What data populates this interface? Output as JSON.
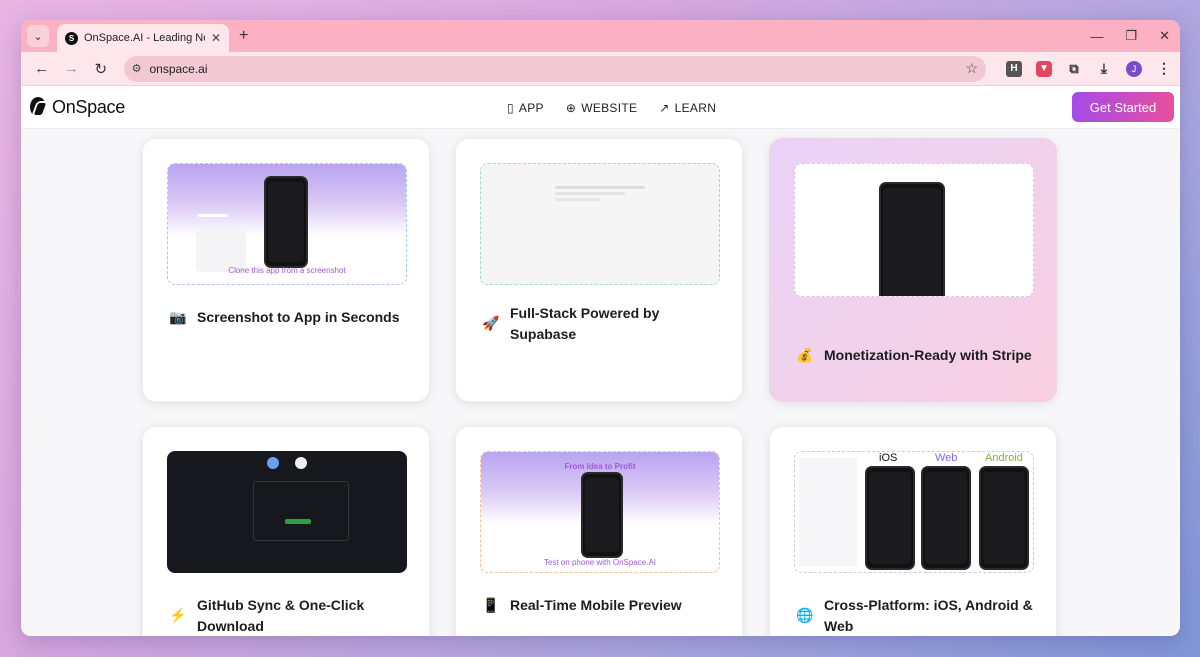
{
  "browser": {
    "tab_title": "OnSpace.AI - Leading No-Code",
    "tab_close": "✕",
    "new_tab": "+",
    "url": "onspace.ai",
    "avatar_initial": "J",
    "ext_h": "H"
  },
  "site": {
    "logo_text": "OnSpace",
    "nav": [
      {
        "label": "APP",
        "icon": "phone-icon"
      },
      {
        "label": "WEBSITE",
        "icon": "globe-icon"
      },
      {
        "label": "LEARN",
        "icon": "arrow-up-right-icon"
      }
    ],
    "cta_label": "Get Started"
  },
  "cards": [
    {
      "emoji": "📷",
      "title": "Screenshot to App in Seconds",
      "caption": "Clone this app from a screenshot"
    },
    {
      "emoji": "🚀",
      "title": "Full-Stack Powered by Supabase"
    },
    {
      "emoji": "💰",
      "title": "Monetization-Ready with Stripe"
    },
    {
      "emoji": "⚡",
      "title": "GitHub Sync & One-Click Download"
    },
    {
      "emoji": "📱",
      "title": "Real-Time Mobile Preview",
      "caption_top": "From Idea to Profit",
      "caption_bottom": "Test on phone with OnSpace.AI"
    },
    {
      "emoji": "🌐",
      "title": "Cross-Platform: iOS, Android & Web",
      "labels": [
        "iOS",
        "Web",
        "Android"
      ]
    }
  ],
  "colors": {
    "cta_start": "#a44bea",
    "cta_end": "#e84f9c",
    "tab_bar": "#fbb1c2"
  }
}
